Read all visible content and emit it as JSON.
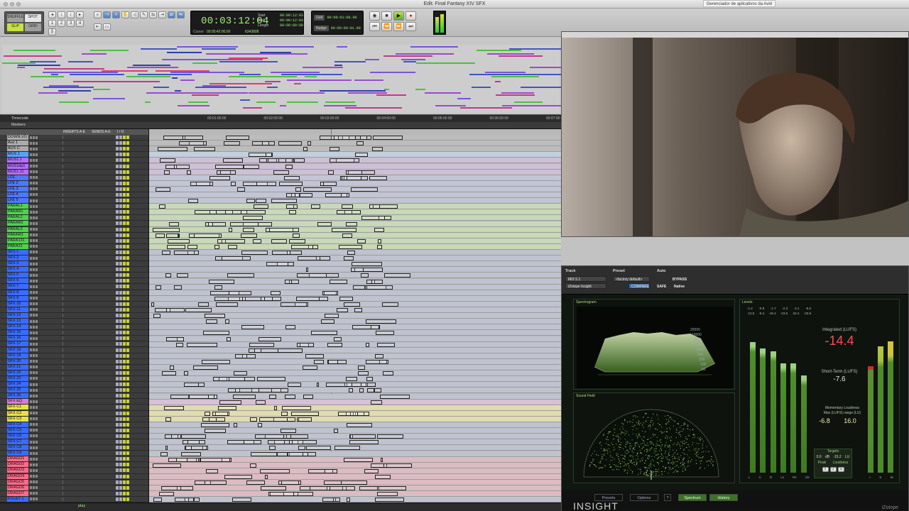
{
  "window": {
    "title": "Edit: Final Fantasy XIV SFX",
    "avid_app_manager": "Gerenciador de aplicativos da Avid"
  },
  "toolbar": {
    "modes": [
      "SHUFFLE",
      "SPOT",
      "SLIP",
      "GRID"
    ],
    "counter": {
      "main": "00:03:12:04",
      "start_label": "Start",
      "start": "00:00:12:03",
      "end_label": "End",
      "end": "00:00:12:03",
      "length_label": "Length",
      "length": "00:00:00:00",
      "cursor_label": "Cursor",
      "cursor": "00:05:42:00.00",
      "sample": "6343808"
    },
    "grid_label": "Grid",
    "grid_value": "00:00:01:00.00",
    "nudge_label": "Nudge",
    "nudge_value": "00:00:00:01.00"
  },
  "rulers": {
    "timecode_label": "Timecode",
    "markers_label": "Markers",
    "ticks": [
      "00:01:00:00",
      "00:02:00:00",
      "00:03:00:00",
      "00:04:00:00",
      "00:05:00:00",
      "00:06:00:00",
      "00:07:00:00"
    ]
  },
  "tracklist_header": {
    "inserts": "INSERTS A-E",
    "sends": "SENDS A-E",
    "io": "I / O"
  },
  "tracks": [
    {
      "name": "DOWN.VO",
      "color": "#aaaaaa"
    },
    {
      "name": "Aux 1",
      "color": "#aaaaaa"
    },
    {
      "name": "AUX C",
      "color": "#aaaaaa"
    },
    {
      "name": "MUS 1",
      "color": "#5aa0ff"
    },
    {
      "name": "MUS1.1",
      "color": "#b56cff"
    },
    {
      "name": "MUS1dp1",
      "color": "#b56cff"
    },
    {
      "name": "MUS1.11",
      "color": "#b56cff"
    },
    {
      "name": "LFE",
      "color": "#4e78ff"
    },
    {
      "name": "LFE 2",
      "color": "#4e78ff"
    },
    {
      "name": "LFE 3",
      "color": "#4e78ff"
    },
    {
      "name": "LFE 4",
      "color": "#4e78ff"
    },
    {
      "name": "LFE 5",
      "color": "#4e78ff"
    },
    {
      "name": "PARAL1",
      "color": "#4fd24f"
    },
    {
      "name": "PARAR1",
      "color": "#4fd24f"
    },
    {
      "name": "PARAL2",
      "color": "#4fd24f"
    },
    {
      "name": "PARAR2",
      "color": "#4fd24f"
    },
    {
      "name": "PARAL3",
      "color": "#4fd24f"
    },
    {
      "name": "PARAR3",
      "color": "#4fd24f"
    },
    {
      "name": "PARA131",
      "color": "#4fd24f"
    },
    {
      "name": "PARA31",
      "color": "#4fd24f"
    },
    {
      "name": "SFX 1",
      "color": "#3a6cff"
    },
    {
      "name": "SFX 2",
      "color": "#3a6cff"
    },
    {
      "name": "SFX 3",
      "color": "#3a6cff"
    },
    {
      "name": "SFX 4",
      "color": "#3a6cff"
    },
    {
      "name": "SFX 5",
      "color": "#3a6cff"
    },
    {
      "name": "SFX 6",
      "color": "#3a6cff"
    },
    {
      "name": "SFX 7",
      "color": "#3a6cff"
    },
    {
      "name": "SFX 8",
      "color": "#3a6cff"
    },
    {
      "name": "SFX 9",
      "color": "#3a6cff"
    },
    {
      "name": "SFX 10",
      "color": "#3a6cff"
    },
    {
      "name": "SFX 11",
      "color": "#3a6cff"
    },
    {
      "name": "SFX 12",
      "color": "#3a6cff"
    },
    {
      "name": "SFX 13",
      "color": "#3a6cff"
    },
    {
      "name": "SFX 14",
      "color": "#3a6cff"
    },
    {
      "name": "SFX 15",
      "color": "#3a6cff"
    },
    {
      "name": "SFX 16",
      "color": "#3a6cff"
    },
    {
      "name": "SFX 17",
      "color": "#3a6cff"
    },
    {
      "name": "SFX 18",
      "color": "#3a6cff"
    },
    {
      "name": "SFX 19",
      "color": "#3a6cff"
    },
    {
      "name": "SFX 20",
      "color": "#3a6cff"
    },
    {
      "name": "SFX 21",
      "color": "#3a6cff"
    },
    {
      "name": "SFX 22",
      "color": "#3a6cff"
    },
    {
      "name": "SFX 23",
      "color": "#3a6cff"
    },
    {
      "name": "SFX 24",
      "color": "#3a6cff"
    },
    {
      "name": "SFX 25",
      "color": "#3a6cff"
    },
    {
      "name": "SFX 26",
      "color": "#3a6cff"
    },
    {
      "name": "SFX EQ",
      "color": "#d97ad6"
    },
    {
      "name": "SFX C1",
      "color": "#e6e04a"
    },
    {
      "name": "SFX C2",
      "color": "#e6e04a"
    },
    {
      "name": "SFX C3",
      "color": "#e6e04a"
    },
    {
      "name": "SFX C4",
      "color": "#3a6cff"
    },
    {
      "name": "SFX C5",
      "color": "#3a6cff"
    },
    {
      "name": "SFX C6",
      "color": "#3a6cff"
    },
    {
      "name": "SFX C7",
      "color": "#3a6cff"
    },
    {
      "name": "SFX C8",
      "color": "#3a6cff"
    },
    {
      "name": "SFX C9",
      "color": "#3a6cff"
    },
    {
      "name": "DRAGO1",
      "color": "#ff6b8a"
    },
    {
      "name": "DRAGO2",
      "color": "#ff6b8a"
    },
    {
      "name": "DRAGO3",
      "color": "#ff6b8a"
    },
    {
      "name": "DRAGO4",
      "color": "#ff6b8a"
    },
    {
      "name": "DRAGO5",
      "color": "#ff6b8a"
    },
    {
      "name": "DRAGO6",
      "color": "#ff6b8a"
    },
    {
      "name": "DRAGO7",
      "color": "#ff6b8a"
    },
    {
      "name": "FOLEY 1",
      "color": "#3a6cff"
    }
  ],
  "status": {
    "play_label": "play"
  },
  "plugin": {
    "track_label": "Track",
    "track_name": "MIX 5.1",
    "preset_label": "Preset",
    "preset_value": "<factory default>",
    "auto_label": "Auto",
    "bypass_label": "BYPASS",
    "plugin_name": "iZotope Insight",
    "compare_label": "COMPARE",
    "safe_label": "SAFE",
    "native_label": "Native",
    "panels": {
      "spectrogram": "Spectrogram",
      "sound_field": "Sound Field",
      "levels": "Levels"
    },
    "spectro_freqs": [
      "20000",
      "10000",
      "5000",
      "2000",
      "1000",
      "500",
      "200",
      "100",
      "50"
    ],
    "level_peaks": [
      "-1.2",
      "-0.9",
      "-1.7",
      "-2.3",
      "-2.1",
      "-5.6"
    ],
    "level_rms": [
      "-12.5",
      "-9.4",
      "-15.2",
      "-23.5",
      "-22.4",
      "-33.8"
    ],
    "level_channels": [
      "L",
      "C",
      "R",
      "Ls",
      "Rs",
      "Lfe"
    ],
    "level_fills": [
      0.86,
      0.82,
      0.8,
      0.72,
      0.72,
      0.64
    ],
    "loudness": {
      "integrated_label": "Integrated (LUFS)",
      "integrated": "-14.4",
      "short_term_label": "Short-Term (LUFS)",
      "short_term": "-7.6",
      "momentary_label": "Momentary  Loudness",
      "max_label": "Max (LUFS)  range (LU)",
      "max_value": "-6.8",
      "range_value": "16.0",
      "targets_label": "Targets",
      "target_db": "0.0",
      "target_db_unit": "dB",
      "target_lufs": "-15.2",
      "target_lufs_unit": "LU",
      "peak_label": "Peak",
      "loudness_label": "Loudness",
      "ism_labels": [
        "I",
        "S",
        "M"
      ]
    },
    "bottom_buttons": {
      "presets": "Presets",
      "options": "Options",
      "help": "?",
      "spectrum": "Spectrum",
      "history": "History"
    },
    "logo": "INSIGHT",
    "vendor": "iZotope"
  },
  "colors": {
    "counter_green": "#9ff07a",
    "integrated_red": "#ff4a4a",
    "insight_green": "#6fae3f"
  }
}
